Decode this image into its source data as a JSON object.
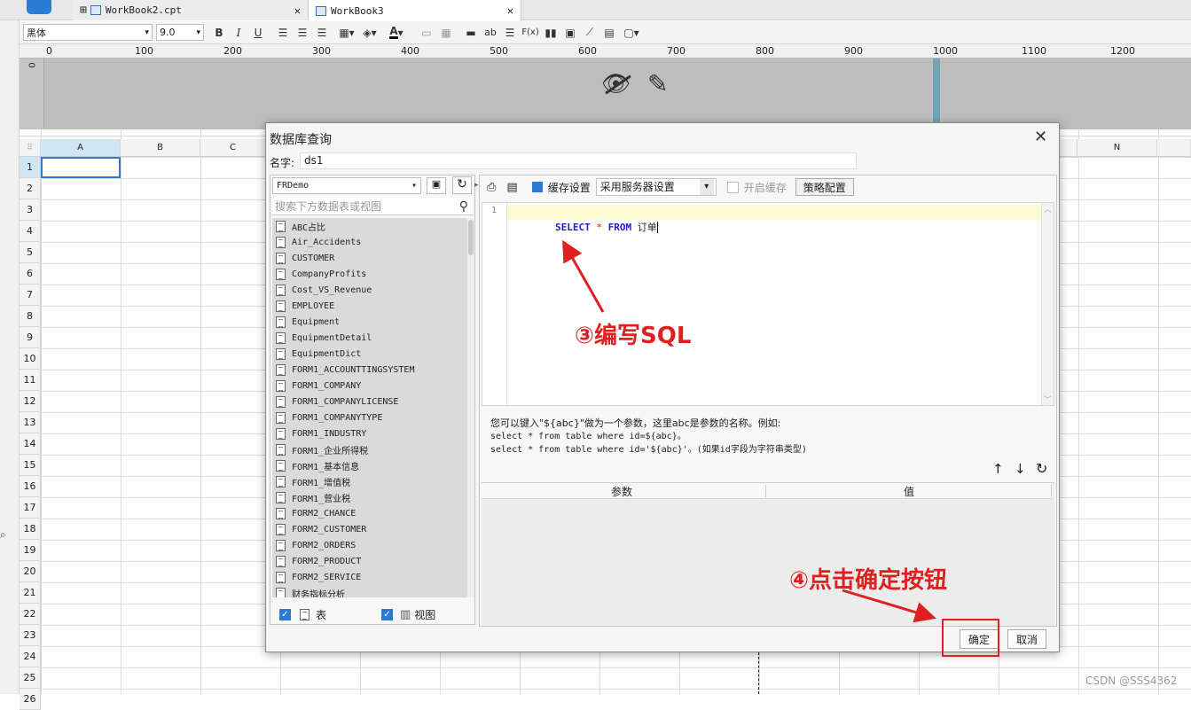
{
  "tabs": [
    {
      "label": "WorkBook2.cpt"
    },
    {
      "label": "WorkBook3"
    }
  ],
  "toolbar": {
    "font_family": "黑体",
    "font_size": "9.0",
    "bold": "B",
    "italic": "I",
    "underline": "U",
    "font_color_glyph": "A",
    "wrap_glyph": "ab",
    "formula_glyph": "F(x)"
  },
  "ruler": {
    "zero": "0",
    "ticks": [
      "0",
      "100",
      "200",
      "300",
      "400",
      "500",
      "600",
      "700",
      "800",
      "900",
      "1000",
      "1100",
      "1200"
    ]
  },
  "sheet": {
    "columns": [
      "A",
      "B",
      "C",
      "N"
    ],
    "rows": [
      "1",
      "2",
      "3",
      "4",
      "5",
      "6",
      "7",
      "8",
      "9",
      "10",
      "11",
      "12",
      "13",
      "14",
      "15",
      "16",
      "17",
      "18",
      "19",
      "20",
      "21",
      "22",
      "23",
      "24",
      "25",
      "26"
    ]
  },
  "dialog": {
    "title": "数据库查询",
    "name_label": "名字:",
    "name_value": "ds1",
    "datasource": "FRDemo",
    "search_placeholder": "搜索下方数据表或视图",
    "tables": [
      "ABC占比",
      "Air_Accidents",
      "CUSTOMER",
      "CompanyProfits",
      "Cost_VS_Revenue",
      "EMPLOYEE",
      "Equipment",
      "EquipmentDetail",
      "EquipmentDict",
      "FORM1_ACCOUNTTINGSYSTEM",
      "FORM1_COMPANY",
      "FORM1_COMPANYLICENSE",
      "FORM1_COMPANYTYPE",
      "FORM1_INDUSTRY",
      "FORM1_企业所得税",
      "FORM1_基本信息",
      "FORM1_增值税",
      "FORM1_营业税",
      "FORM2_CHANCE",
      "FORM2_CUSTOMER",
      "FORM2_ORDERS",
      "FORM2_PRODUCT",
      "FORM2_SERVICE",
      "财务指标分析"
    ],
    "show_tables_label": "表",
    "show_views_label": "视图",
    "cache_settings_label": "缓存设置",
    "cache_mode": "采用服务器设置",
    "enable_cache_label": "开启缓存",
    "strategy_label": "策略配置",
    "sql": {
      "line_no": "1",
      "kw_select": "SELECT",
      "star": "*",
      "kw_from": "FROM",
      "table": "订单"
    },
    "help_lines": [
      "您可以键入\"${abc}\"做为一个参数，这里abc是参数的名称。例如:",
      "select * from table where id=${abc}。",
      "select * from table where id='${abc}'。(如果id字段为字符串类型)"
    ],
    "param_col_name": "参数",
    "param_col_value": "值",
    "ok_label": "确定",
    "cancel_label": "取消"
  },
  "annotations": {
    "write_sql": "③编写SQL",
    "click_ok": "④点击确定按钮"
  },
  "watermark": "CSDN @SSS4362",
  "colors": {
    "accent": "#2a7bd3",
    "annotation": "#e02020",
    "sql_keyword": "#1c1ccf",
    "current_line": "#fbfbd2"
  }
}
